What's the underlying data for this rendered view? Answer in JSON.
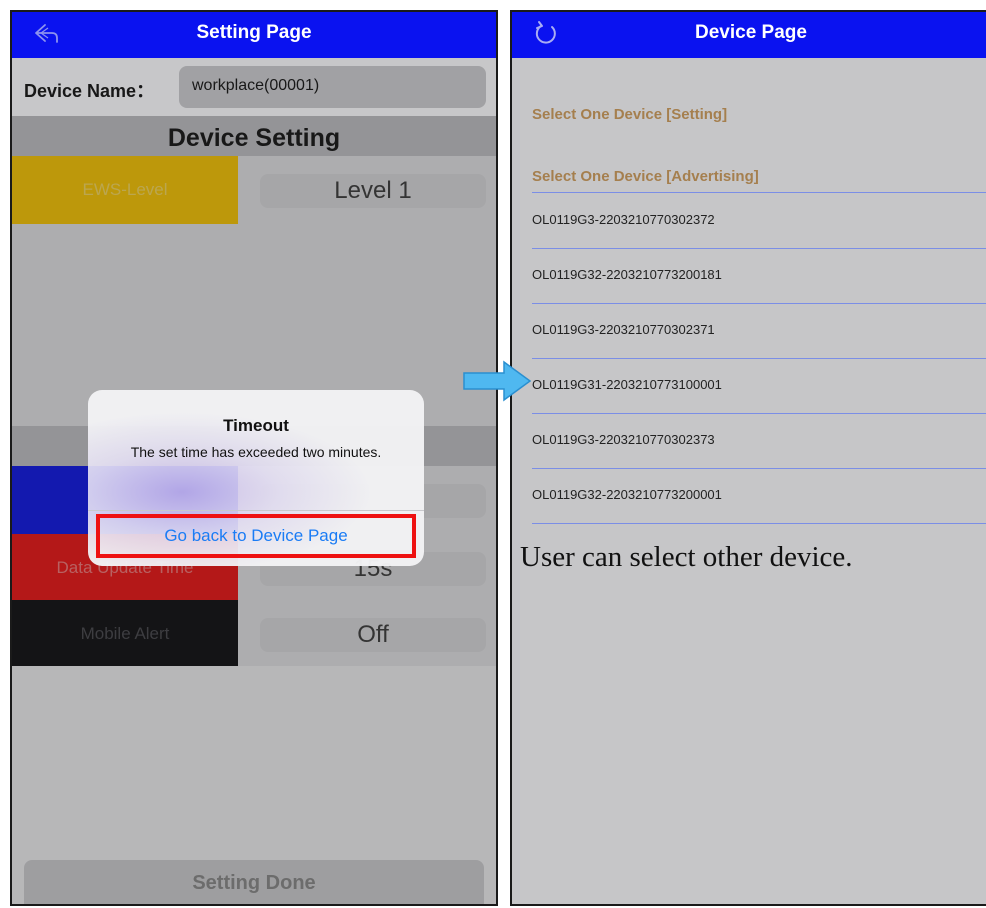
{
  "left_screen": {
    "nav_title": "Setting Page",
    "device_name_label": "Device Name：",
    "device_name_value": "workplace(00001)",
    "section_title": "Device Setting",
    "settings": [
      {
        "label": "EWS-Level",
        "value": "Level 1",
        "label_bg": "#d9ad00",
        "label_color": "#d7be55"
      },
      {
        "label": "",
        "value": "",
        "label_bg": "#0a12c8",
        "label_color": "#6a6ad0"
      },
      {
        "label": "Data Update Time",
        "value": "15s",
        "label_bg": "#cf1111",
        "label_color": "#d46a6a"
      },
      {
        "label": "Mobile Alert",
        "value": "Off",
        "label_bg": "#0c0c0e",
        "label_color": "#3e3e42"
      }
    ],
    "setting_done_label": "Setting Done",
    "back_icon": "back-arrow-icon"
  },
  "alert": {
    "title": "Timeout",
    "message": "The set time has exceeded two minutes.",
    "button_label": "Go back to Device Page",
    "highlight_color": "#ee1111"
  },
  "right_screen": {
    "nav_title": "Device Page",
    "refresh_icon": "refresh-icon",
    "section_setting": "Select One Device [Setting]",
    "section_advertising": "Select One Device [Advertising]",
    "devices": [
      "OL0119G3-2203210770302372",
      "OL0119G32-2203210773200181",
      "OL0119G3-2203210770302371",
      "OL0119G31-2203210773100001",
      "OL0119G3-2203210770302373",
      "OL0119G32-2203210773200001"
    ]
  },
  "caption": "User can select other device.",
  "colors": {
    "nav_bar": "#0a12f0",
    "section_link": "#a57f4e",
    "row_divider": "#7b8ee6",
    "arrow": "#4fb8f0"
  }
}
